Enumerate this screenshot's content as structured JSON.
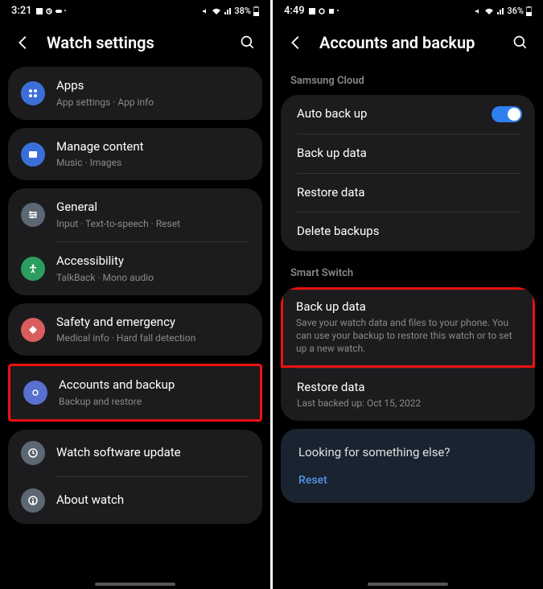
{
  "left": {
    "status": {
      "time": "3:21",
      "battery": "38%"
    },
    "header": {
      "title": "Watch settings"
    },
    "items": {
      "apps": {
        "title": "Apps",
        "sub": "App settings · App info"
      },
      "content": {
        "title": "Manage content",
        "sub": "Music · Images"
      },
      "general": {
        "title": "General",
        "sub": "Input · Text-to-speech · Reset"
      },
      "accessibility": {
        "title": "Accessibility",
        "sub": "TalkBack · Mono audio"
      },
      "safety": {
        "title": "Safety and emergency",
        "sub": "Medical info · Hard fall detection"
      },
      "accounts": {
        "title": "Accounts and backup",
        "sub": "Backup and restore"
      },
      "update": {
        "title": "Watch software update"
      },
      "about": {
        "title": "About watch"
      }
    }
  },
  "right": {
    "status": {
      "time": "4:49",
      "battery": "36%"
    },
    "header": {
      "title": "Accounts and backup"
    },
    "sections": {
      "cloud_label": "Samsung Cloud",
      "switch_label": "Smart Switch"
    },
    "cloud": {
      "auto": "Auto back up",
      "backup": "Back up data",
      "restore": "Restore data",
      "delete": "Delete backups"
    },
    "switch": {
      "backup": {
        "title": "Back up data",
        "sub": "Save your watch data and files to your phone. You can use your backup to restore this watch or to set up a new watch."
      },
      "restore": {
        "title": "Restore data",
        "sub": "Last backed up: Oct 15, 2022"
      }
    },
    "tip": {
      "title": "Looking for something else?",
      "link": "Reset"
    }
  }
}
